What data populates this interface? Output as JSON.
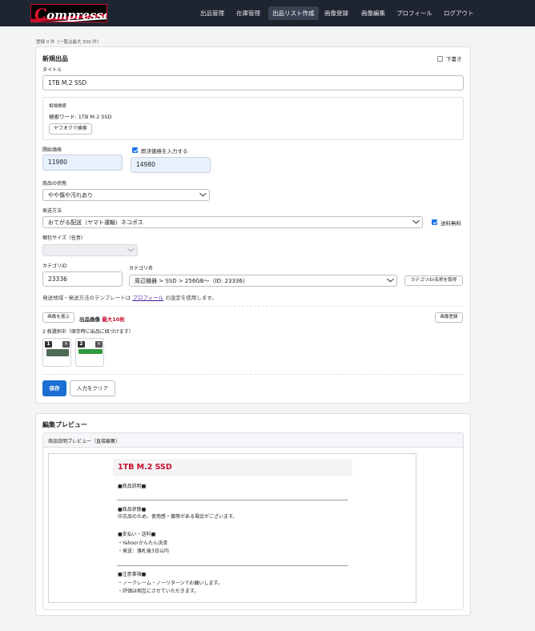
{
  "nav": {
    "logo": "Compressor",
    "items": [
      {
        "label": "出品管理",
        "active": false
      },
      {
        "label": "在庫管理",
        "active": false
      },
      {
        "label": "出品リスト作成",
        "active": true
      },
      {
        "label": "画像登録",
        "active": false
      },
      {
        "label": "画像編集",
        "active": false
      },
      {
        "label": "プロフィール",
        "active": false
      },
      {
        "label": "ログアウト",
        "active": false
      }
    ]
  },
  "registered_count": "登録 0 件（一覧は最大 500 件）",
  "form": {
    "heading": "新規出品",
    "draft_label": "下書き",
    "title_label": "タイトル",
    "title_value": "1TB  M.2 SSD",
    "market": {
      "heading": "相場検索",
      "keyword_label": "検索ワード: ",
      "keyword_value": "1TB M.2 SSD",
      "search_button": "ヤフオクで検索"
    },
    "start_price_label": "開始価格",
    "start_price_value": "11980",
    "buyout_checkbox_label": "即決価格を入力する",
    "buyout_value": "14980",
    "condition_label": "商品の状態",
    "condition_value": "やや傷や汚れあり",
    "shipping_label": "発送方法",
    "shipping_value": "おてがる配送（ヤマト運輸）ネコポス",
    "free_shipping_label": "送料無料",
    "package_size_label": "梱包サイズ（任意）",
    "package_size_value": "",
    "category_id_label": "カテゴリID",
    "category_id_value": "23336",
    "category_name_label": "カテゴリ名",
    "category_name_value": "周辺機器 > SSD > 256GB〜（ID: 23336）",
    "category_fetch_button": "カテゴリID/名称を取得",
    "template_note_prefix": "発送地域・発送方法のテンプレートは ",
    "template_note_link": "プロフィール",
    "template_note_suffix": " の設定を使用します。",
    "select_image_button": "画像を選ぶ",
    "image_label": "出品画像",
    "image_max": "最大10枚",
    "image_register_button": "画像登録",
    "selected_count": "2 枚選択中（保存時に出品に紐づけます）",
    "thumbs": [
      {
        "index": "1",
        "remove": "×"
      },
      {
        "index": "2",
        "remove": "×"
      }
    ],
    "save_button": "保存",
    "clear_button": "入力をクリア"
  },
  "preview": {
    "heading": "編集プレビュー",
    "subheading": "商品説明プレビュー（直接編集）",
    "product_title": "1TB M.2 SSD",
    "desc_heading": "■商品説明■",
    "condition_heading": "■商品状態■",
    "condition_text": "中古品のため、使用感・傷等がある場合がございます。",
    "payment_heading": "■支払い・送料■",
    "payment_line1": "・Yahoo!かんたん決済",
    "payment_line2": "・発送：落札後3日以内",
    "notes_heading": "■注意事項■",
    "notes_line1": "・ノークレーム・ノーリターンでお願いします。",
    "notes_line2": "・評価は相互にさせていただきます。"
  },
  "colors": {
    "nav_bg": "#1f2431",
    "primary": "#1a6fd1",
    "accent_red": "#c8102e",
    "checkbox_blue": "#1a73e8"
  }
}
